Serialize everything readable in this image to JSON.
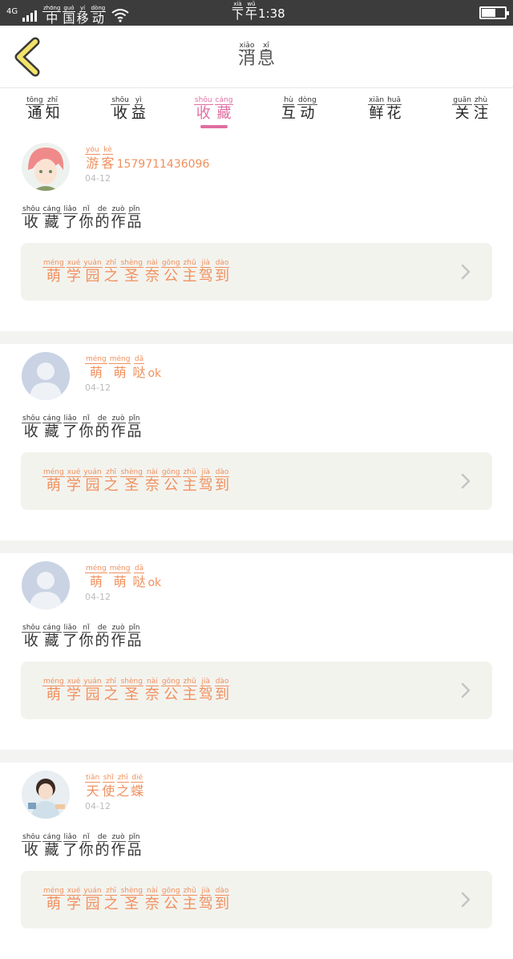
{
  "status": {
    "network": "4G",
    "carrier": [
      {
        "py": "zhōng",
        "hz": "中"
      },
      {
        "py": "guó",
        "hz": "国"
      },
      {
        "py": "yí",
        "hz": "移"
      },
      {
        "py": "dòng",
        "hz": "动"
      }
    ],
    "time_prefix": [
      {
        "py": "xià",
        "hz": "下"
      },
      {
        "py": "wǔ",
        "hz": "午"
      }
    ],
    "time": "1:38",
    "battery_level": 0.56
  },
  "header": {
    "title": [
      {
        "py": "xiāo",
        "hz": "消"
      },
      {
        "py": "xī",
        "hz": "息"
      }
    ]
  },
  "tabs": [
    {
      "chars": [
        {
          "py": "tōng",
          "hz": "通"
        },
        {
          "py": "zhī",
          "hz": "知"
        }
      ],
      "active": false
    },
    {
      "chars": [
        {
          "py": "shōu",
          "hz": "收"
        },
        {
          "py": "yì",
          "hz": "益"
        }
      ],
      "active": false
    },
    {
      "chars": [
        {
          "py": "shōu",
          "hz": "收"
        },
        {
          "py": "cáng",
          "hz": "藏"
        }
      ],
      "active": true
    },
    {
      "chars": [
        {
          "py": "hù",
          "hz": "互"
        },
        {
          "py": "dòng",
          "hz": "动"
        }
      ],
      "active": false
    },
    {
      "chars": [
        {
          "py": "xiān",
          "hz": "鲜"
        },
        {
          "py": "huā",
          "hz": "花"
        }
      ],
      "active": false
    },
    {
      "chars": [
        {
          "py": "guān",
          "hz": "关"
        },
        {
          "py": "zhù",
          "hz": "注"
        }
      ],
      "active": false
    }
  ],
  "items": [
    {
      "avatar": "anime-boy-avatar",
      "user_chars": [
        {
          "py": "yóu",
          "hz": "游"
        },
        {
          "py": "kè",
          "hz": "客"
        }
      ],
      "user_rest": "15797114360​96",
      "date": "04-12",
      "action": [
        {
          "py": "shōu",
          "hz": "收"
        },
        {
          "py": "cáng",
          "hz": "藏"
        },
        {
          "py": "liǎo",
          "hz": "了"
        },
        {
          "py": "nǐ",
          "hz": "你"
        },
        {
          "py": "de",
          "hz": "的"
        },
        {
          "py": "zuò",
          "hz": "作"
        },
        {
          "py": "pǐn",
          "hz": "品"
        }
      ],
      "work": [
        {
          "py": "méng",
          "hz": "萌"
        },
        {
          "py": "xué",
          "hz": "学"
        },
        {
          "py": "yuán",
          "hz": "园"
        },
        {
          "py": "zhī",
          "hz": "之"
        },
        {
          "py": "shèng",
          "hz": "圣"
        },
        {
          "py": "nài",
          "hz": "奈"
        },
        {
          "py": "gōng",
          "hz": "公"
        },
        {
          "py": "zhǔ",
          "hz": "主"
        },
        {
          "py": "jià",
          "hz": "驾"
        },
        {
          "py": "dào",
          "hz": "到"
        }
      ]
    },
    {
      "avatar": "default-user-avatar",
      "user_chars": [
        {
          "py": "méng",
          "hz": "萌"
        },
        {
          "py": "méng",
          "hz": "萌"
        },
        {
          "py": "dā",
          "hz": "哒"
        }
      ],
      "user_rest": "ok",
      "date": "04-12",
      "action": [
        {
          "py": "shōu",
          "hz": "收"
        },
        {
          "py": "cáng",
          "hz": "藏"
        },
        {
          "py": "liǎo",
          "hz": "了"
        },
        {
          "py": "nǐ",
          "hz": "你"
        },
        {
          "py": "de",
          "hz": "的"
        },
        {
          "py": "zuò",
          "hz": "作"
        },
        {
          "py": "pǐn",
          "hz": "品"
        }
      ],
      "work": [
        {
          "py": "méng",
          "hz": "萌"
        },
        {
          "py": "xué",
          "hz": "学"
        },
        {
          "py": "yuán",
          "hz": "园"
        },
        {
          "py": "zhī",
          "hz": "之"
        },
        {
          "py": "shèng",
          "hz": "圣"
        },
        {
          "py": "nài",
          "hz": "奈"
        },
        {
          "py": "gōng",
          "hz": "公"
        },
        {
          "py": "zhǔ",
          "hz": "主"
        },
        {
          "py": "jià",
          "hz": "驾"
        },
        {
          "py": "dào",
          "hz": "到"
        }
      ]
    },
    {
      "avatar": "default-user-avatar",
      "user_chars": [
        {
          "py": "méng",
          "hz": "萌"
        },
        {
          "py": "méng",
          "hz": "萌"
        },
        {
          "py": "dā",
          "hz": "哒"
        }
      ],
      "user_rest": "ok",
      "date": "04-12",
      "action": [
        {
          "py": "shōu",
          "hz": "收"
        },
        {
          "py": "cáng",
          "hz": "藏"
        },
        {
          "py": "liǎo",
          "hz": "了"
        },
        {
          "py": "nǐ",
          "hz": "你"
        },
        {
          "py": "de",
          "hz": "的"
        },
        {
          "py": "zuò",
          "hz": "作"
        },
        {
          "py": "pǐn",
          "hz": "品"
        }
      ],
      "work": [
        {
          "py": "méng",
          "hz": "萌"
        },
        {
          "py": "xué",
          "hz": "学"
        },
        {
          "py": "yuán",
          "hz": "园"
        },
        {
          "py": "zhī",
          "hz": "之"
        },
        {
          "py": "shèng",
          "hz": "圣"
        },
        {
          "py": "nài",
          "hz": "奈"
        },
        {
          "py": "gōng",
          "hz": "公"
        },
        {
          "py": "zhǔ",
          "hz": "主"
        },
        {
          "py": "jià",
          "hz": "驾"
        },
        {
          "py": "dào",
          "hz": "到"
        }
      ]
    },
    {
      "avatar": "girl-photo-avatar",
      "user_chars": [
        {
          "py": "tiān",
          "hz": "天"
        },
        {
          "py": "shǐ",
          "hz": "使"
        },
        {
          "py": "zhī",
          "hz": "之"
        },
        {
          "py": "dié",
          "hz": "蝶"
        }
      ],
      "user_rest": "",
      "date": "04-12",
      "action": [
        {
          "py": "shōu",
          "hz": "收"
        },
        {
          "py": "cáng",
          "hz": "藏"
        },
        {
          "py": "liǎo",
          "hz": "了"
        },
        {
          "py": "nǐ",
          "hz": "你"
        },
        {
          "py": "de",
          "hz": "的"
        },
        {
          "py": "zuò",
          "hz": "作"
        },
        {
          "py": "pǐn",
          "hz": "品"
        }
      ],
      "work": [
        {
          "py": "méng",
          "hz": "萌"
        },
        {
          "py": "xué",
          "hz": "学"
        },
        {
          "py": "yuán",
          "hz": "园"
        },
        {
          "py": "zhī",
          "hz": "之"
        },
        {
          "py": "shèng",
          "hz": "圣"
        },
        {
          "py": "nài",
          "hz": "奈"
        },
        {
          "py": "gōng",
          "hz": "公"
        },
        {
          "py": "zhǔ",
          "hz": "主"
        },
        {
          "py": "jià",
          "hz": "驾"
        },
        {
          "py": "dào",
          "hz": "到"
        }
      ]
    }
  ],
  "colors": {
    "accent_pink": "#e06ea0",
    "accent_orange": "#f0905e",
    "card_bg": "#f3f3ee",
    "back_yellow": "#f2e36a"
  }
}
